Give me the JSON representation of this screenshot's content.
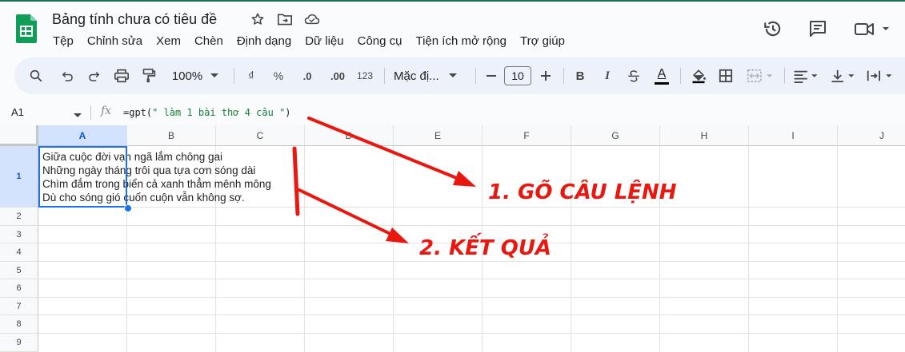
{
  "app": {
    "title": "Bảng tính chưa có tiêu đề",
    "accent_color": "#0f9d58",
    "title_icons": [
      "star-icon",
      "move-to-folder-icon",
      "cloud-saved-icon"
    ],
    "menu": [
      "Tệp",
      "Chỉnh sửa",
      "Xem",
      "Chèn",
      "Định dạng",
      "Dữ liệu",
      "Công cụ",
      "Tiện ích mở rộng",
      "Trợ giúp"
    ],
    "header_right_icons": [
      "history-icon",
      "comment-icon",
      "meet-video-icon"
    ]
  },
  "toolbar": {
    "zoom": "100%",
    "currency_label": "₫",
    "percent_label": "%",
    "decrease_decimal_label": ".0",
    "increase_decimal_label": ".00",
    "number_format_label": "123",
    "font_name": "Mặc đị...",
    "font_size": "10",
    "bold_label": "B",
    "italic_label": "I",
    "text_color_label": "A",
    "icons": [
      "search-icon",
      "undo-icon",
      "redo-icon",
      "print-icon",
      "paint-format-icon",
      "strikethrough-icon",
      "fill-color-icon",
      "borders-icon",
      "merge-cells-icon",
      "align-left-icon",
      "valign-bottom-icon",
      "text-wrap-icon"
    ]
  },
  "formula_bar": {
    "cell_ref": "A1",
    "fx_label": "fx",
    "formula_prefix": "=gpt(",
    "formula_string": "\" làm 1 bài thơ 4 câu \"",
    "formula_suffix": ")"
  },
  "grid": {
    "columns": [
      "A",
      "B",
      "C",
      "D",
      "E",
      "F",
      "G",
      "H",
      "I",
      "J"
    ],
    "rows": [
      "1",
      "2",
      "3",
      "4",
      "5",
      "6",
      "7",
      "8",
      "9"
    ],
    "selected_cell": "A1",
    "cell_a1_lines": [
      "Giữa cuộc đời vạn ngã lắm chông gai",
      "Những ngày tháng trôi qua tựa cơn sóng dài",
      "Chìm đắm trong biển cả xanh thẳm mênh mông",
      "Dù cho sóng gió cuốn cuộn vẫn không sợ."
    ]
  },
  "annotations": {
    "color": "#e8170f",
    "step1": "1. GÕ CÂU LỆNH",
    "step2": "2. KẾT QUẢ"
  }
}
